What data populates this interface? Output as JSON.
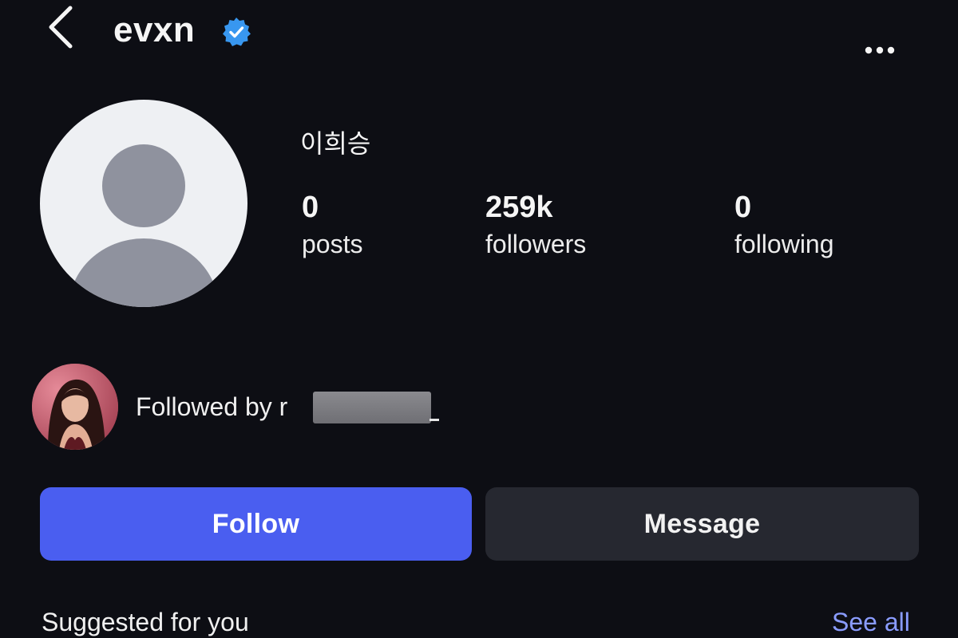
{
  "header": {
    "username": "evxn",
    "verified_icon": "verified-badge-icon",
    "back_icon": "chevron-left-icon",
    "more_icon": "more-horizontal-icon"
  },
  "profile": {
    "full_name": "이희승",
    "avatar_icon": "default-user-avatar-icon"
  },
  "stats": [
    {
      "value": "0",
      "label": "posts"
    },
    {
      "value": "259k",
      "label": "followers"
    },
    {
      "value": "0",
      "label": "following"
    }
  ],
  "followed_by": {
    "prefix": "Followed by",
    "visible_initial": "r"
  },
  "actions": {
    "follow_label": "Follow",
    "message_label": "Message"
  },
  "suggested": {
    "title": "Suggested for you",
    "see_all_label": "See all"
  },
  "colors": {
    "background": "#0d0e14",
    "follow_button": "#4a5ef0",
    "message_button": "#262830",
    "verified_badge": "#3897f0",
    "link": "#8a9cff"
  }
}
